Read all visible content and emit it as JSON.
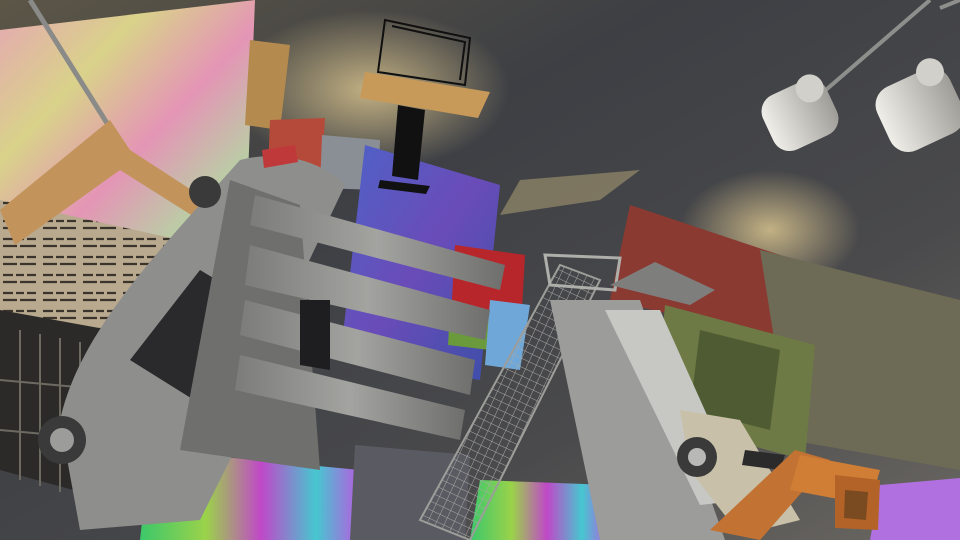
{
  "scene": {
    "description_free": true,
    "palette": {
      "sky_dark": "#2f3136",
      "sky_light": "#6b6a66",
      "sun_glow": "#c9b27a",
      "metal_gray": "#8f8f8d",
      "metal_light": "#b9b9b6",
      "wood_tan": "#c99756",
      "wood_orange": "#c8742e",
      "block_purple": "#5a4fb0",
      "block_red": "#b8272a",
      "grass_green": "#6a9a3a",
      "ground_rainbow_a": "#4ec06a",
      "ground_rainbow_b": "#b03bd0",
      "lamp_white": "#e4e2dc"
    },
    "objects": [
      {
        "name": "overturned-car",
        "kind": "vehicle"
      },
      {
        "name": "gray-bin",
        "kind": "container"
      },
      {
        "name": "shopping-cart",
        "kind": "cart"
      },
      {
        "name": "small-car",
        "kind": "vehicle"
      },
      {
        "name": "coat-hanger",
        "kind": "hanger"
      },
      {
        "name": "stool-table",
        "kind": "furniture"
      },
      {
        "name": "wooden-chair",
        "kind": "furniture"
      },
      {
        "name": "hanging-lamps",
        "kind": "lamp"
      },
      {
        "name": "colored-blocks",
        "kind": "blocks"
      },
      {
        "name": "poster-walls",
        "kind": "walls"
      }
    ]
  }
}
